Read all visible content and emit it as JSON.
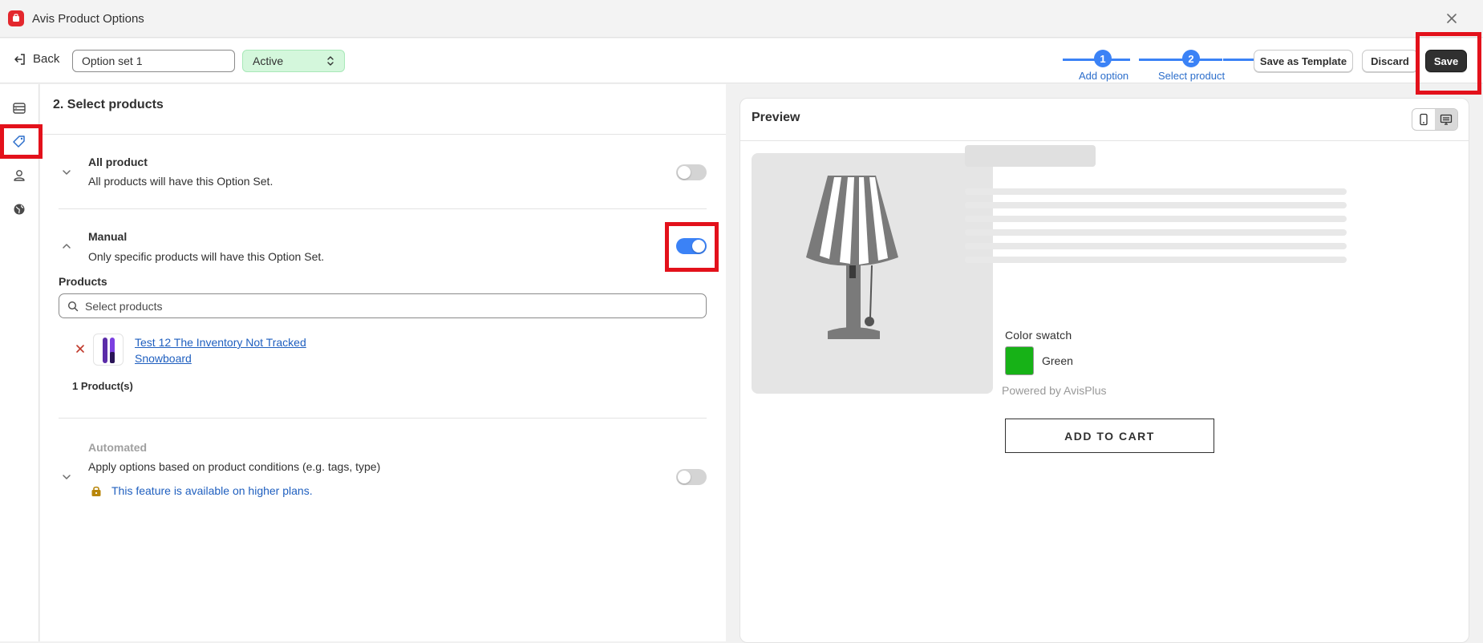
{
  "app": {
    "title": "Avis Product Options"
  },
  "toolbar": {
    "back_label": "Back",
    "option_set_name": "Option set 1",
    "status_value": "Active",
    "steps": [
      {
        "number": "1",
        "label": "Add option"
      },
      {
        "number": "2",
        "label": "Select product"
      }
    ],
    "save_template_label": "Save as Template",
    "discard_label": "Discard",
    "save_label": "Save"
  },
  "main": {
    "title": "2. Select products",
    "all_product": {
      "title": "All product",
      "description": "All products will have this Option Set.",
      "enabled": false
    },
    "manual": {
      "title": "Manual",
      "description": "Only specific products will have this Option Set.",
      "enabled": true,
      "products_label": "Products",
      "search_placeholder": "Select products",
      "product_name": "Test 12 The Inventory Not Tracked Snowboard",
      "product_count": "1 Product(s)"
    },
    "automated": {
      "title": "Automated",
      "description": "Apply options based on product conditions (e.g. tags, type)",
      "enabled": false,
      "locked_note": "This feature is available on higher plans."
    }
  },
  "preview": {
    "title": "Preview",
    "swatch_label": "Color swatch",
    "swatch_color": "#17b217",
    "swatch_name": "Green",
    "powered_by": "Powered by AvisPlus",
    "add_to_cart": "ADD TO CART"
  },
  "colors": {
    "accent": "#3b82f6",
    "highlight": "#e3111b",
    "status_bg": "#d4f7dc"
  }
}
